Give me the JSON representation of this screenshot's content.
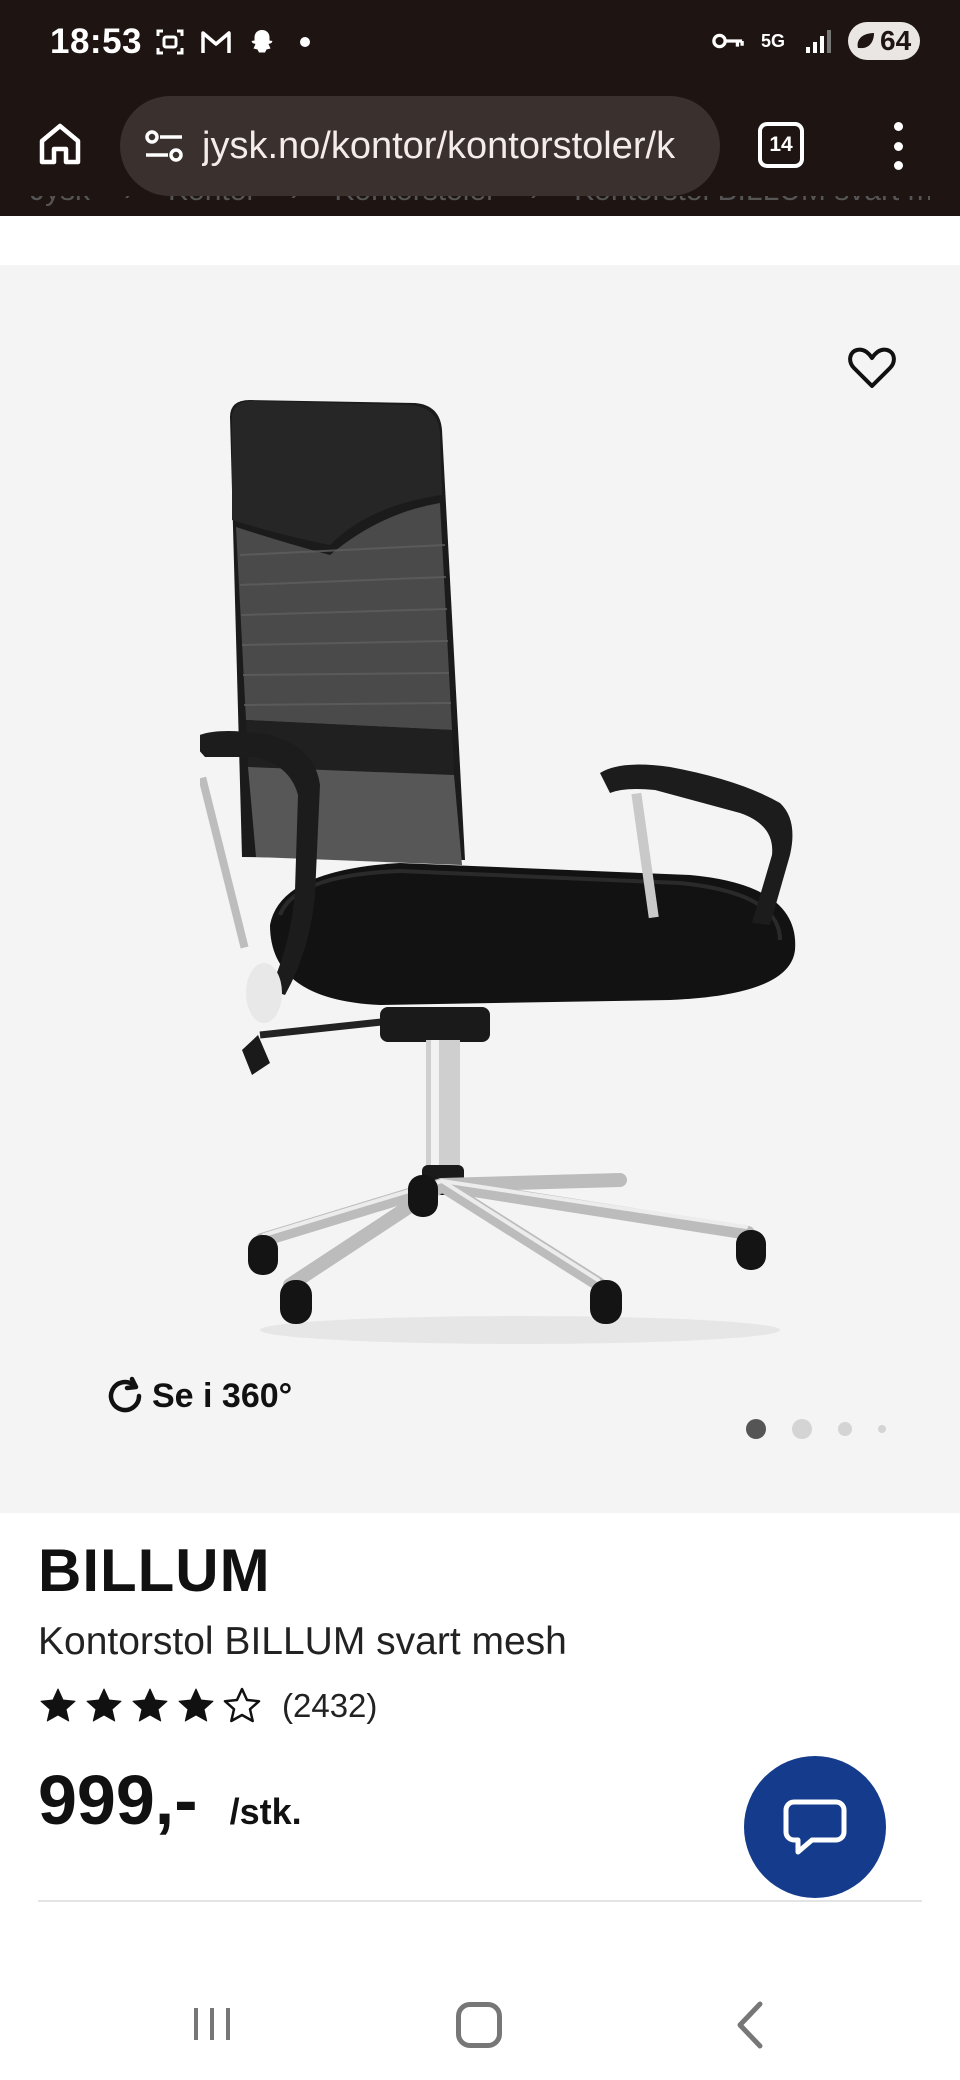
{
  "status_bar": {
    "time": "18:53",
    "network": "5G",
    "battery": "64",
    "icons": [
      "screenshot-icon",
      "gmail-icon",
      "snapchat-icon",
      "notification-dot",
      "vpn-key-icon",
      "signal-icon",
      "battery-icon"
    ]
  },
  "browser": {
    "url": "jysk.no/kontor/kontorstoler/k",
    "tab_count": "14",
    "icons": [
      "home-icon",
      "site-settings-icon",
      "tabs-icon",
      "more-menu-icon"
    ]
  },
  "breadcrumb": [
    "Jysk",
    "Kontor",
    "Kontorstoler",
    "Kontorstol BILLUM svart m"
  ],
  "gallery": {
    "view_360_label": "Se i 360°",
    "image_count": 4,
    "active_image": 1
  },
  "product": {
    "brand": "BILLUM",
    "name": "Kontorstol BILLUM svart mesh",
    "rating_stars": 4,
    "rating_max": 5,
    "review_count": "(2432)",
    "price": "999,-",
    "unit": "/stk."
  },
  "colors": {
    "status_bar_bg": "#1e1412",
    "url_pill_bg": "#3a302d",
    "gallery_bg": "#f4f4f4",
    "chat_button": "#143b8c"
  }
}
